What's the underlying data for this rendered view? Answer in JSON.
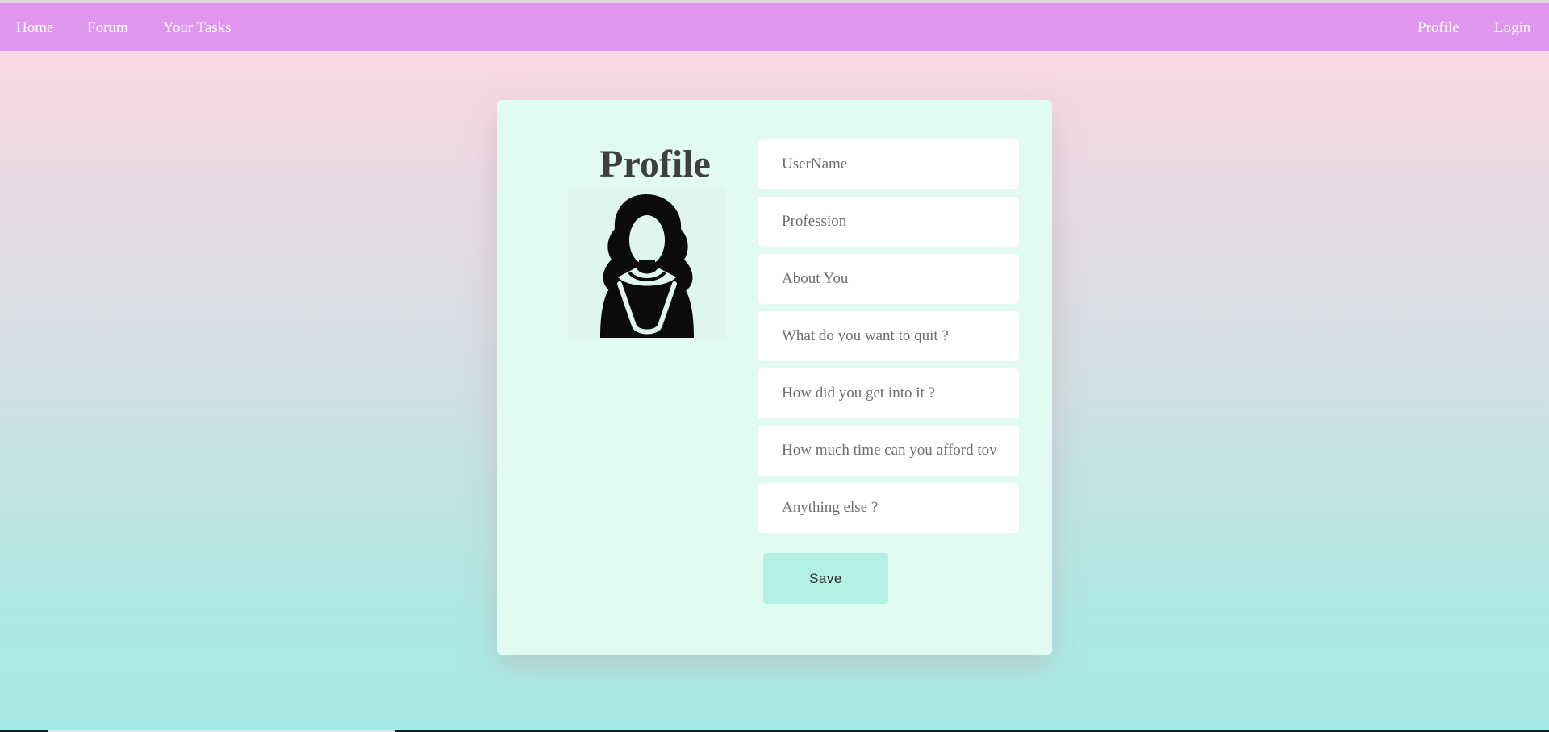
{
  "nav": {
    "left": {
      "home": "Home",
      "forum": "Forum",
      "tasks": "Your Tasks"
    },
    "right": {
      "profile": "Profile",
      "login": "Login"
    }
  },
  "profile": {
    "title": "Profile",
    "avatar_icon": "woman-avatar-icon"
  },
  "form": {
    "fields": [
      {
        "name": "username",
        "placeholder": "UserName",
        "value": ""
      },
      {
        "name": "profession",
        "placeholder": "Profession",
        "value": ""
      },
      {
        "name": "about",
        "placeholder": "About You",
        "value": ""
      },
      {
        "name": "quit",
        "placeholder": "What do you want to quit ?",
        "value": ""
      },
      {
        "name": "how",
        "placeholder": "How did you get into it ?",
        "value": ""
      },
      {
        "name": "time",
        "placeholder": "How much time can you afford tov",
        "value": ""
      },
      {
        "name": "else",
        "placeholder": "Anything else ?",
        "value": ""
      }
    ],
    "save_label": "Save"
  },
  "colors": {
    "navbar": "#df96ee",
    "card": "#e1fbf2",
    "save_button": "#b4f0e4",
    "gradient_top": "#fbd9e5",
    "gradient_bottom": "#a8ebe6"
  }
}
